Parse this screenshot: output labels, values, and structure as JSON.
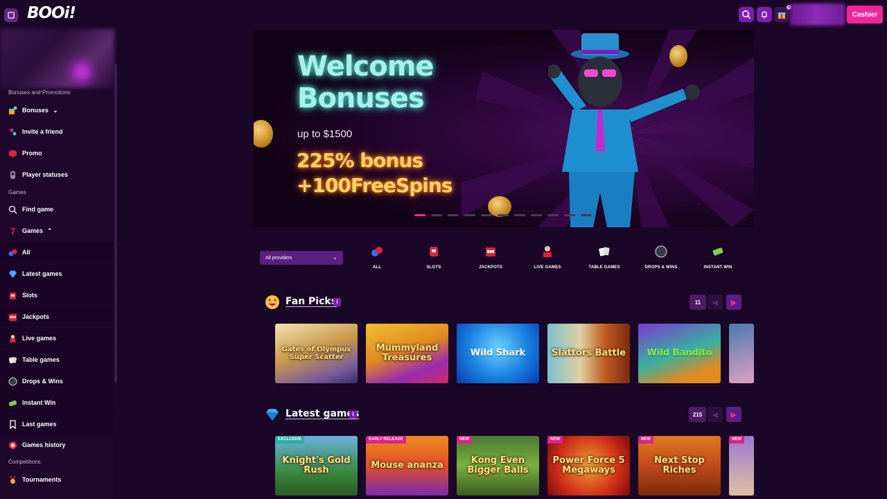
{
  "app": {
    "logo": "BOOi!"
  },
  "header": {
    "notification_count": "4",
    "cashier_label": "Cashier"
  },
  "sidebar": {
    "sections": {
      "bonuses": "Bonuses and Promotions",
      "games": "Games",
      "competitions": "Competitions"
    },
    "items": {
      "bonuses": "Bonuses",
      "invite": "Invite a friend",
      "promo": "Promo",
      "player_statuses": "Player statuses",
      "find_game": "Find game",
      "games": "Games",
      "all": "All",
      "latest_games": "Latest games",
      "slots": "Slots",
      "jackpots": "Jackpots",
      "live_games": "Live games",
      "table_games": "Table games",
      "drops_wins": "Drops & Wins",
      "instant_win": "Instant Win",
      "last_games": "Last games",
      "games_history": "Games history",
      "tournaments": "Tournaments"
    }
  },
  "banner": {
    "title_line1": "Welcome",
    "title_line2": "Bonuses",
    "subtitle": "up to $1500",
    "bonus_line1": "225% bonus",
    "bonus_line2": "+100FreeSpins",
    "slide_count": 11,
    "active_slide": 1
  },
  "filters": {
    "providers_selected": "All providers",
    "categories": [
      "ALL",
      "SLOTS",
      "JACKPOTS",
      "LIVE GAMES",
      "TABLE GAMES",
      "DROPS & WINS",
      "INSTANT WIN"
    ]
  },
  "fan_picks": {
    "title": "Fan Picks",
    "info": "i",
    "count": "11",
    "games": [
      "Gates of Olympus Super Scatter",
      "Mummyland Treasures",
      "Wild Shark",
      "Slattors Battle",
      "Wild Bandito"
    ]
  },
  "latest_games": {
    "title": "Latest games",
    "info": "i",
    "count": "215",
    "games": [
      {
        "name": "Knight's Gold Rush",
        "tag": "EXCLUSIVE"
      },
      {
        "name": "Mouse ananza",
        "tag": "EARLY RELEASE"
      },
      {
        "name": "Kong Even Bigger Balls",
        "tag": "NEW"
      },
      {
        "name": "Power Force 5 Megaways",
        "tag": "NEW"
      },
      {
        "name": "Next Stop Riches",
        "tag": "NEW"
      },
      {
        "name": "",
        "tag": "NEW"
      }
    ]
  },
  "colors": {
    "accent": "#f0259c",
    "primary": "#7b1fb0",
    "background": "#1a0626"
  }
}
